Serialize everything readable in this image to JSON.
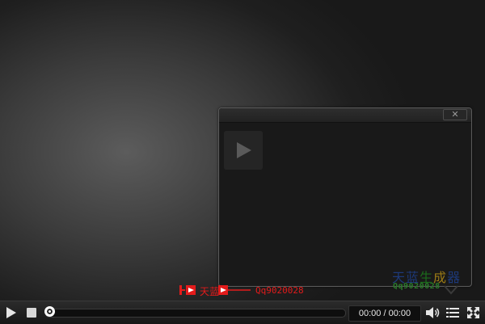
{
  "popup": {
    "close_label": "✕",
    "play_icon": "play-icon"
  },
  "watermark": {
    "cn_chars": [
      "天",
      "蓝",
      "生",
      "成",
      "器"
    ],
    "sub_text": "Qq9020028",
    "colors": {
      "blue": "#1e3f8a",
      "green": "#1b7a1b",
      "gold": "#b08a15"
    }
  },
  "branding": {
    "logo_text": "天蓝",
    "contact": "Qq9020028",
    "color": "#e31b1b"
  },
  "controls": {
    "play_icon": "play-icon",
    "stop_icon": "stop-icon",
    "progress": 0,
    "time_display": "00:00 / 00:00",
    "volume_icon": "volume-icon",
    "playlist_icon": "playlist-icon",
    "fullscreen_icon": "fullscreen-icon"
  }
}
